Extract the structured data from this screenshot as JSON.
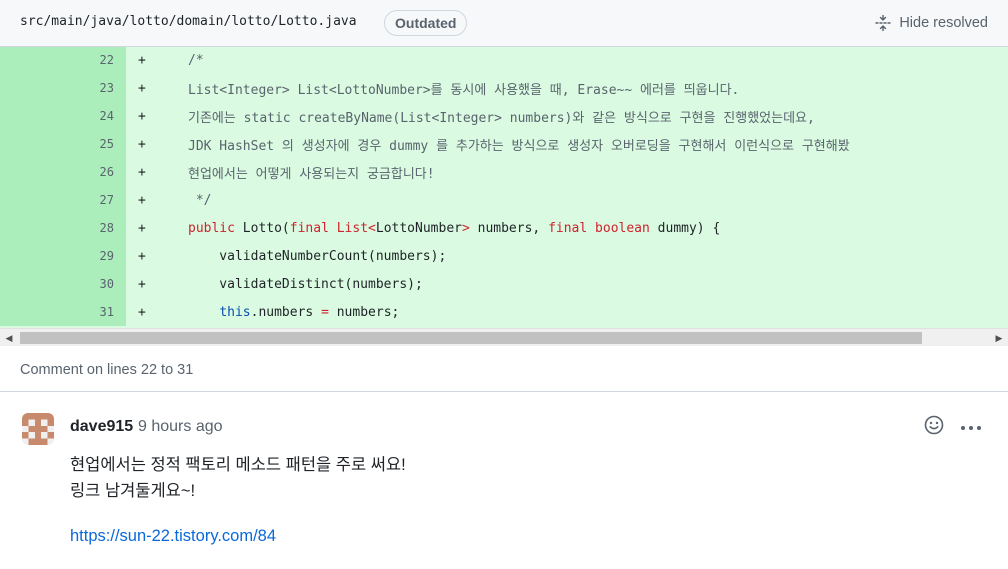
{
  "file": {
    "path": "src/main/java/lotto/domain/lotto/Lotto.java",
    "badge": "Outdated",
    "hide_resolved_label": "Hide resolved"
  },
  "code_lines": [
    {
      "num": "22",
      "sign": "+",
      "parts": [
        {
          "t": "/*",
          "c": "plain-gray"
        }
      ]
    },
    {
      "num": "23",
      "sign": "+",
      "parts": [
        {
          "t": "List<Integer> List<LottoNumber>를 동시에 사용했을 때, Erase~~ 에러를 띄웁니다.",
          "c": "plain-gray"
        }
      ]
    },
    {
      "num": "24",
      "sign": "+",
      "parts": [
        {
          "t": "기존에는 static createByName(List<Integer> numbers)와 같은 방식으로 구현을 진행했었는데요,",
          "c": "plain-gray"
        }
      ]
    },
    {
      "num": "25",
      "sign": "+",
      "parts": [
        {
          "t": "JDK HashSet 의 생성자에 경우 dummy 를 추가하는 방식으로 생성자 오버로딩을 구현해서 이런식으로 구현해봤",
          "c": "plain-gray"
        }
      ]
    },
    {
      "num": "26",
      "sign": "+",
      "parts": [
        {
          "t": "현업에서는 어떻게 사용되는지 궁금합니다!",
          "c": "plain-gray"
        }
      ]
    },
    {
      "num": "27",
      "sign": "+",
      "parts": [
        {
          "t": " */",
          "c": "plain-gray"
        }
      ]
    },
    {
      "num": "28",
      "sign": "+",
      "parts": [
        {
          "t": "public",
          "c": "kw"
        },
        {
          "t": " Lotto(",
          "c": "plain"
        },
        {
          "t": "final",
          "c": "kw"
        },
        {
          "t": " ",
          "c": "plain"
        },
        {
          "t": "List<",
          "c": "kw"
        },
        {
          "t": "LottoNumber",
          "c": "plain"
        },
        {
          "t": ">",
          "c": "kw"
        },
        {
          "t": " numbers, ",
          "c": "plain"
        },
        {
          "t": "final",
          "c": "kw"
        },
        {
          "t": " ",
          "c": "plain"
        },
        {
          "t": "boolean",
          "c": "kw"
        },
        {
          "t": " dummy) {",
          "c": "plain"
        }
      ]
    },
    {
      "num": "29",
      "sign": "+",
      "parts": [
        {
          "t": "    validateNumberCount(numbers);",
          "c": "plain"
        }
      ]
    },
    {
      "num": "30",
      "sign": "+",
      "parts": [
        {
          "t": "    validateDistinct(numbers);",
          "c": "plain"
        }
      ]
    },
    {
      "num": "31",
      "sign": "+",
      "parts": [
        {
          "t": "    ",
          "c": "plain"
        },
        {
          "t": "this",
          "c": "this"
        },
        {
          "t": ".numbers ",
          "c": "plain"
        },
        {
          "t": "=",
          "c": "kw"
        },
        {
          "t": " numbers;",
          "c": "plain"
        }
      ]
    }
  ],
  "comment_header": "Comment on lines 22 to 31",
  "comment": {
    "author": "dave915",
    "time": "9 hours ago",
    "body_lines": [
      "현업에서는 정적 팩토리 메소드 패턴을 주로 써요!",
      "링크 남겨둘게요~!"
    ],
    "link": "https://sun-22.tistory.com/84"
  },
  "icons": {
    "hide_resolved": "unfold-icon",
    "emoji": "smiley-icon",
    "more": "kebab-horizontal-icon",
    "avatar": "identicon-avatar"
  },
  "colors": {
    "added_bg": "#dafbe1",
    "added_num_bg": "#aceebb",
    "keyword": "#cf222e",
    "link": "#0969da",
    "avatar": "#c88a6c"
  }
}
